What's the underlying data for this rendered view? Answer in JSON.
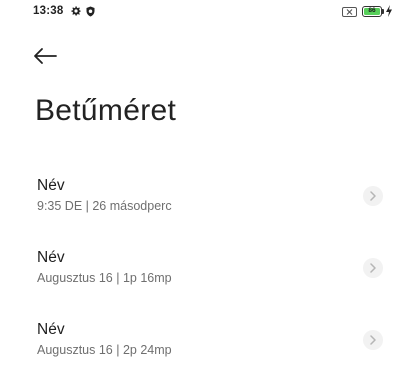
{
  "status_bar": {
    "time": "13:38",
    "battery_level": "86",
    "icons": [
      "settings-gear-icon",
      "shield-icon",
      "sim-off-icon",
      "battery-icon",
      "charging-bolt-icon"
    ],
    "battery_color": "#57d05a"
  },
  "header": {
    "back_icon": "arrow-left-icon",
    "title": "Betűméret"
  },
  "list": {
    "items": [
      {
        "title": "Név",
        "subtitle": "9:35 DE | 26 másodperc",
        "chevron": "chevron-right-icon"
      },
      {
        "title": "Név",
        "subtitle": "Augusztus 16 | 1p 16mp",
        "chevron": "chevron-right-icon"
      },
      {
        "title": "Név",
        "subtitle": "Augusztus 16 | 2p 24mp",
        "chevron": "chevron-right-icon"
      }
    ]
  }
}
